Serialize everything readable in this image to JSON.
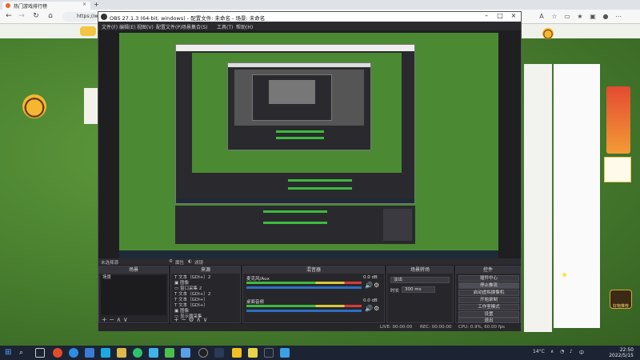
{
  "browser": {
    "tab_title": "热门游戏排行榜",
    "url": "https://w",
    "tab_close": "×",
    "new_tab": "+"
  },
  "obs": {
    "title": "OBS 27.1.3 (64-bit, windows) - 配置文件: 未命名 - 场景: 未命名",
    "menu": [
      "文件(F)",
      "编辑(E)",
      "视图(V)",
      "配置文件(P)",
      "场景集合(S)",
      "工具(T)",
      "帮助(H)"
    ],
    "source_bar": {
      "label": "未选择源",
      "props": "属性",
      "filters": "滤镜"
    },
    "scenes": {
      "header": "场景",
      "items": [
        "场景"
      ]
    },
    "sources": {
      "header": "来源",
      "items": [
        "文本（GDI+）2",
        "图像",
        "窗口采集 2",
        "文本（GDI+）2",
        "文本（GDI+）",
        "文本（GDI+）",
        "图像",
        "显示器采集"
      ]
    },
    "mixer": {
      "header": "混音器",
      "channels": [
        {
          "name": "麦克风/Aux",
          "db": "0.0 dB"
        },
        {
          "name": "桌面音频",
          "db": "0.0 dB"
        }
      ]
    },
    "transitions": {
      "header": "场景转场",
      "type": "淡出",
      "duration_label": "时长",
      "duration": "300 ms"
    },
    "controls": {
      "header": "控件",
      "buttons": [
        "插件中心",
        "停止推流",
        "启动虚拟摄像机",
        "开始录制",
        "工作室模式",
        "设置",
        "退出"
      ]
    },
    "status": {
      "live": "LIVE: 00:00:00",
      "rec": "REC: 00:00:00",
      "cpu": "CPU: 0.9%, 60.00 fps"
    }
  },
  "taskbar": {
    "weather": "14°C",
    "ime": "中",
    "time": "22:50",
    "date": "2022/5/15"
  },
  "badge": {
    "label": "好物推荐"
  },
  "colors": {
    "obs_bg": "#1f1f22",
    "taskbar": "#1c2433",
    "grass": "#4a8230",
    "accent": "#3b5b8a"
  }
}
